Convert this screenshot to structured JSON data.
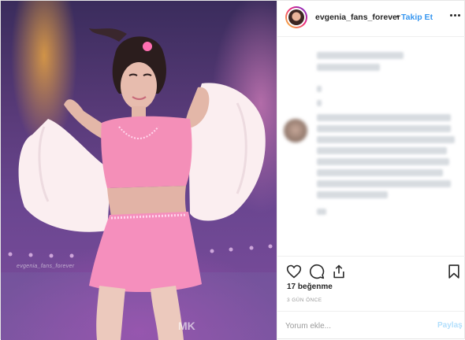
{
  "header": {
    "username": "evgenia_fans_forever",
    "separator": "•",
    "follow_label": "Takip Et",
    "more_icon": "more-horizontal-icon"
  },
  "photo": {
    "watermark": "evgenia_fans_forever",
    "corner_text": "MK"
  },
  "actions": {
    "icons": [
      "heart-icon",
      "comment-icon",
      "share-icon",
      "bookmark-icon"
    ],
    "likes_text": "17 beğenme",
    "time_text": "3 GÜN ÖNCE"
  },
  "comment": {
    "placeholder": "Yorum ekle...",
    "share_label": "Paylaş"
  },
  "colors": {
    "link": "#3897f0",
    "share_disabled": "#b2dffc",
    "muted": "#999999",
    "text": "#262626"
  }
}
